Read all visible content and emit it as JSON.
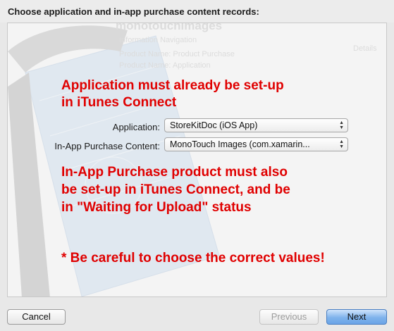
{
  "dialog": {
    "title": "Choose application and in-app purchase content records:"
  },
  "background": {
    "faded_lines": [
      "monotouchimages",
      "Information Navigation",
      "Product Name: Product Purchase",
      "Product Name: Application",
      "Details"
    ]
  },
  "notes": {
    "note1_line1": "Application must already be set-up",
    "note1_line2": "in iTunes Connect",
    "note2_line1": "In-App Purchase product must also",
    "note2_line2": "be set-up in iTunes Connect, and be",
    "note2_line3": "in \"Waiting for Upload\" status",
    "note3": "* Be careful to choose the correct values!"
  },
  "form": {
    "application_label": "Application:",
    "application_value": "StoreKitDoc (iOS App)",
    "iap_label": "In-App Purchase Content:",
    "iap_value": "MonoTouch Images (com.xamarin..."
  },
  "buttons": {
    "cancel": "Cancel",
    "previous": "Previous",
    "next": "Next"
  },
  "colors": {
    "note_red": "#e00000",
    "primary_blue": "#6aa4e6"
  }
}
